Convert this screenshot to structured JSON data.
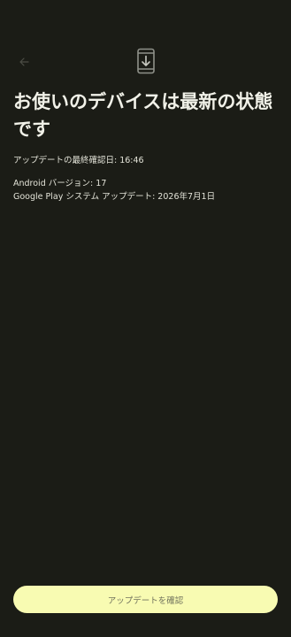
{
  "header": {
    "back_icon": "arrow-back-icon",
    "hero_icon": "phone-download-icon"
  },
  "main": {
    "title": "お使いのデバイスは最新の状態です",
    "last_checked": "アップデートの最終確認日: 16:46",
    "android_version": "Android バージョン: 17",
    "play_system_update": "Google Play システム アップデート: 2026年7月1日"
  },
  "footer": {
    "check_button_label": "アップデートを確認"
  },
  "colors": {
    "background": "#1b1c16",
    "button_fill": "#f8fbb2",
    "button_text": "#71735d"
  }
}
